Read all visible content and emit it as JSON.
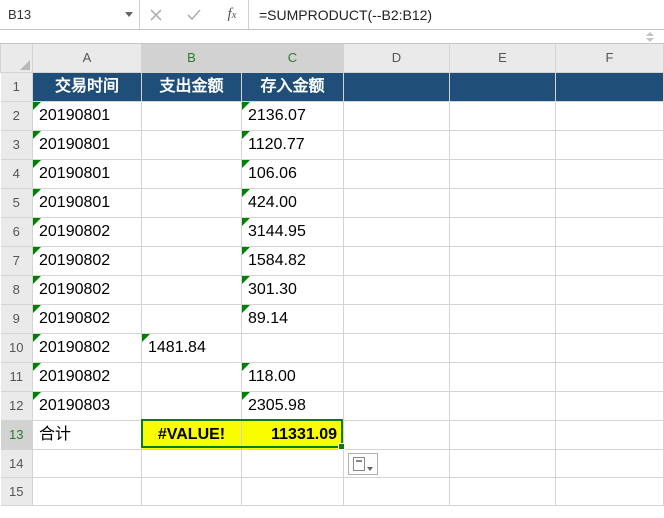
{
  "namebox": "B13",
  "formula": "=SUMPRODUCT(--B2:B12)",
  "columns": [
    "A",
    "B",
    "C",
    "D",
    "E",
    "F"
  ],
  "headers": {
    "colA": "交易时间",
    "colB": "支出金额",
    "colC": "存入金额"
  },
  "rows": [
    {
      "r": 2,
      "a": "20190801",
      "b": "",
      "c": "2136.07"
    },
    {
      "r": 3,
      "a": "20190801",
      "b": "",
      "c": "1120.77"
    },
    {
      "r": 4,
      "a": "20190801",
      "b": "",
      "c": "106.06"
    },
    {
      "r": 5,
      "a": "20190801",
      "b": "",
      "c": "424.00"
    },
    {
      "r": 6,
      "a": "20190802",
      "b": "",
      "c": "3144.95"
    },
    {
      "r": 7,
      "a": "20190802",
      "b": "",
      "c": "1584.82"
    },
    {
      "r": 8,
      "a": "20190802",
      "b": "",
      "c": "301.30"
    },
    {
      "r": 9,
      "a": "20190802",
      "b": "",
      "c": "89.14"
    },
    {
      "r": 10,
      "a": "20190802",
      "b": "1481.84",
      "c": ""
    },
    {
      "r": 11,
      "a": "20190802",
      "b": "",
      "c": "118.00"
    },
    {
      "r": 12,
      "a": "20190803",
      "b": "",
      "c": "2305.98"
    }
  ],
  "totals": {
    "label": "合计",
    "b": "#VALUE!",
    "c": "11331.09"
  },
  "selection": {
    "row": 13,
    "cols": [
      "B",
      "C"
    ]
  },
  "colors": {
    "header_fill": "#1f4e79",
    "totals_fill": "#ffff00",
    "selection_border": "#107c10",
    "text_triangle": "#008000"
  }
}
